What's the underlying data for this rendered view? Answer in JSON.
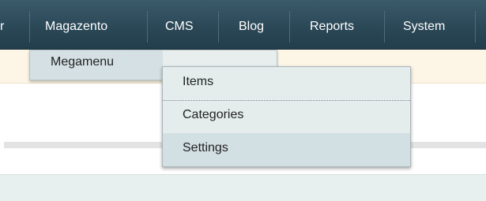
{
  "nav": {
    "partial_label": "r",
    "items": [
      {
        "label": "Magazento"
      },
      {
        "label": "CMS"
      },
      {
        "label": "Blog"
      },
      {
        "label": "Reports"
      },
      {
        "label": "System"
      }
    ]
  },
  "submenu": {
    "item": "Megamenu"
  },
  "flyout": {
    "items": [
      {
        "label": "Items"
      },
      {
        "label": "Categories"
      },
      {
        "label": "Settings"
      }
    ]
  }
}
